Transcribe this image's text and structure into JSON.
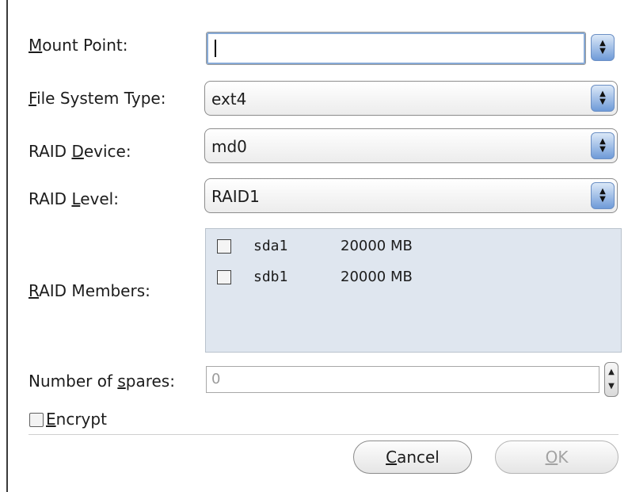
{
  "form": {
    "mount_point": {
      "label_mn": "M",
      "label_rest": "ount Point:",
      "value": ""
    },
    "fs_type": {
      "label_mn": "F",
      "label_rest": "ile System Type:",
      "value": "ext4"
    },
    "raid_device": {
      "label_pre": "RAID ",
      "label_mn": "D",
      "label_rest": "evice:",
      "value": "md0"
    },
    "raid_level": {
      "label_pre": "RAID ",
      "label_mn": "L",
      "label_rest": "evel:",
      "value": "RAID1"
    },
    "raid_members": {
      "label_mn": "R",
      "label_rest": "AID Members:",
      "items": [
        {
          "name": "sda1",
          "size": "20000 MB"
        },
        {
          "name": "sdb1",
          "size": "20000 MB"
        }
      ]
    },
    "spares": {
      "label_pre": "Number of ",
      "label_mn": "s",
      "label_rest": "pares:",
      "value": "0"
    },
    "encrypt": {
      "label_mn": "E",
      "label_rest": "ncrypt"
    }
  },
  "buttons": {
    "cancel": {
      "mn": "C",
      "rest": "ancel"
    },
    "ok": {
      "mn": "O",
      "rest": "K"
    }
  }
}
